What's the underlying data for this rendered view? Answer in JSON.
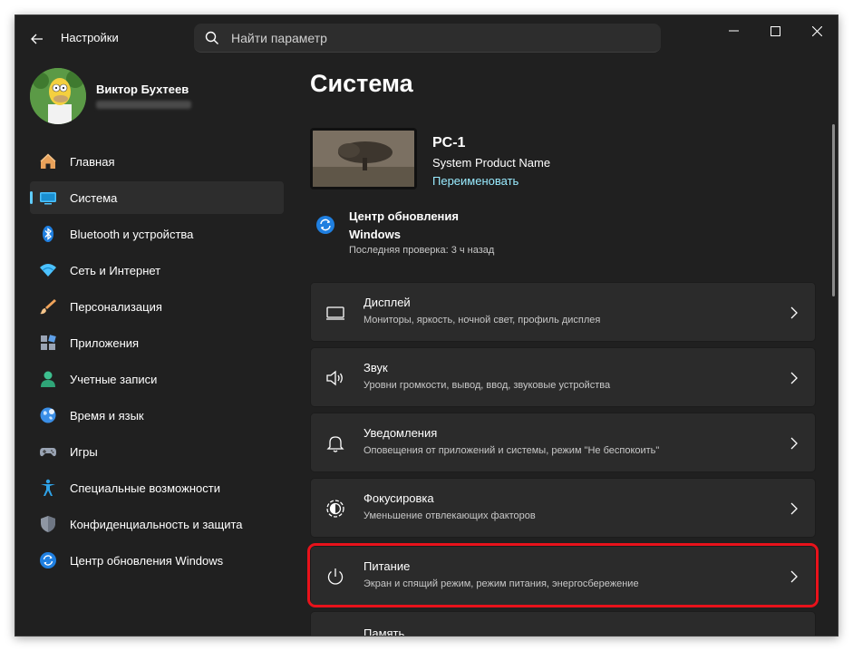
{
  "titlebar": {
    "app_title": "Настройки",
    "search_placeholder": "Найти параметр",
    "icons": [
      "back-arrow-icon",
      "search-icon",
      "minimize-icon",
      "maximize-icon",
      "close-icon"
    ]
  },
  "profile": {
    "name": "Виктор Бухтеев"
  },
  "nav": {
    "items": [
      {
        "label": "Главная",
        "icon": "home-icon"
      },
      {
        "label": "Система",
        "icon": "system-icon",
        "active": true
      },
      {
        "label": "Bluetooth и устройства",
        "icon": "bluetooth-icon"
      },
      {
        "label": "Сеть и Интернет",
        "icon": "wifi-icon"
      },
      {
        "label": "Персонализация",
        "icon": "brush-icon"
      },
      {
        "label": "Приложения",
        "icon": "apps-icon"
      },
      {
        "label": "Учетные записи",
        "icon": "account-icon"
      },
      {
        "label": "Время и язык",
        "icon": "globe-icon"
      },
      {
        "label": "Игры",
        "icon": "gamepad-icon"
      },
      {
        "label": "Специальные возможности",
        "icon": "accessibility-icon"
      },
      {
        "label": "Конфиденциальность и защита",
        "icon": "shield-icon"
      },
      {
        "label": "Центр обновления Windows",
        "icon": "update-icon"
      }
    ]
  },
  "main": {
    "title": "Система",
    "pc": {
      "name": "PC-1",
      "model": "System Product Name",
      "rename_link": "Переименовать"
    },
    "update": {
      "title": "Центр обновления Windows",
      "last_check": "Последняя проверка: 3 ч назад"
    },
    "cards": [
      {
        "title": "Дисплей",
        "desc": "Мониторы, яркость, ночной свет, профиль дисплея",
        "icon": "display-icon"
      },
      {
        "title": "Звук",
        "desc": "Уровни громкости, вывод, ввод, звуковые устройства",
        "icon": "speaker-icon"
      },
      {
        "title": "Уведомления",
        "desc": "Оповещения от приложений и системы, режим \"Не беспокоить\"",
        "icon": "bell-icon"
      },
      {
        "title": "Фокусировка",
        "desc": "Уменьшение отвлекающих факторов",
        "icon": "focus-icon"
      },
      {
        "title": "Питание",
        "desc": "Экран и спящий режим, режим питания, энергосбережение",
        "icon": "power-icon",
        "highlighted": true
      },
      {
        "title": "Память",
        "desc": "",
        "icon": "storage-icon"
      }
    ]
  },
  "colors": {
    "accent": "#60cdff",
    "highlight": "#e8121b",
    "background": "#202020",
    "card": "#2b2b2b"
  }
}
